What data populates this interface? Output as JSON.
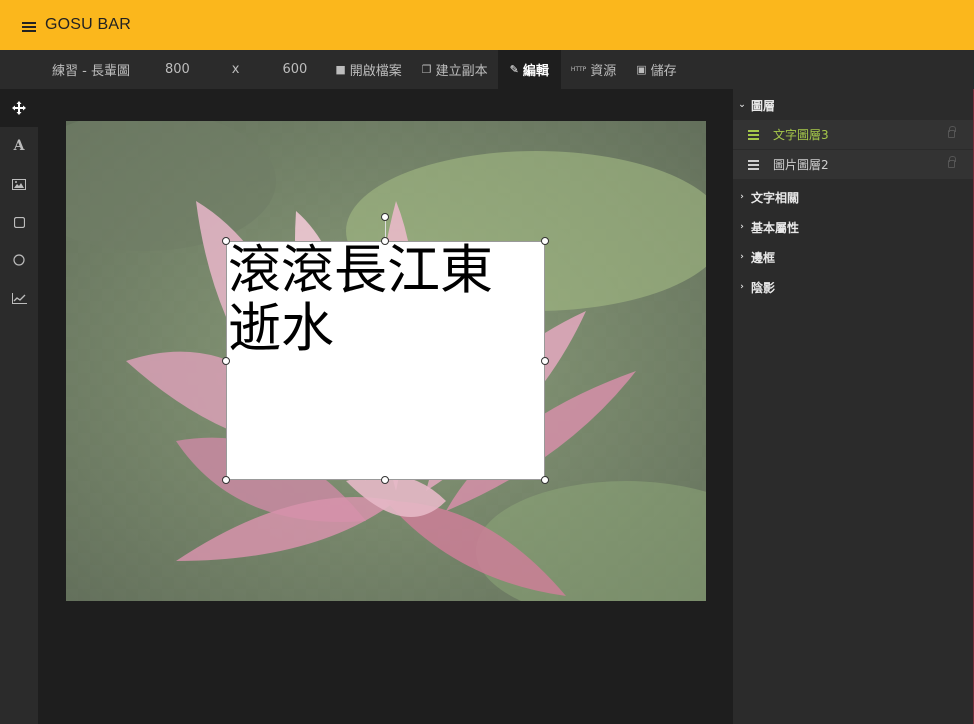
{
  "app": {
    "title": "GOSU BAR"
  },
  "toolbar": {
    "project_name": "練習 - 長輩圖",
    "width": "800",
    "times": "x",
    "height": "600",
    "open_label": "開啟檔案",
    "copy_label": "建立副本",
    "edit_label": "編輯",
    "resource_label": "資源",
    "save_label": "儲存",
    "resource_icon_text": "HTTP"
  },
  "tools": [
    {
      "name": "move-tool",
      "icon": "move-icon"
    },
    {
      "name": "text-tool",
      "icon": "text-icon"
    },
    {
      "name": "image-tool",
      "icon": "image-icon"
    },
    {
      "name": "rectangle-tool",
      "icon": "square-icon"
    },
    {
      "name": "circle-tool",
      "icon": "circle-icon"
    },
    {
      "name": "chart-tool",
      "icon": "line-chart-icon"
    }
  ],
  "canvas": {
    "text": "滾滾長江東逝水"
  },
  "panel": {
    "layers_title": "圖層",
    "layers": [
      {
        "label": "文字圖層3",
        "selected": true
      },
      {
        "label": "圖片圖層2",
        "selected": false
      }
    ],
    "sections": [
      "文字相關",
      "基本屬性",
      "邊框",
      "陰影"
    ]
  },
  "colors": {
    "header": "#fbb71c",
    "selected_layer": "#a6c94a",
    "background": "#1e1e1e"
  }
}
